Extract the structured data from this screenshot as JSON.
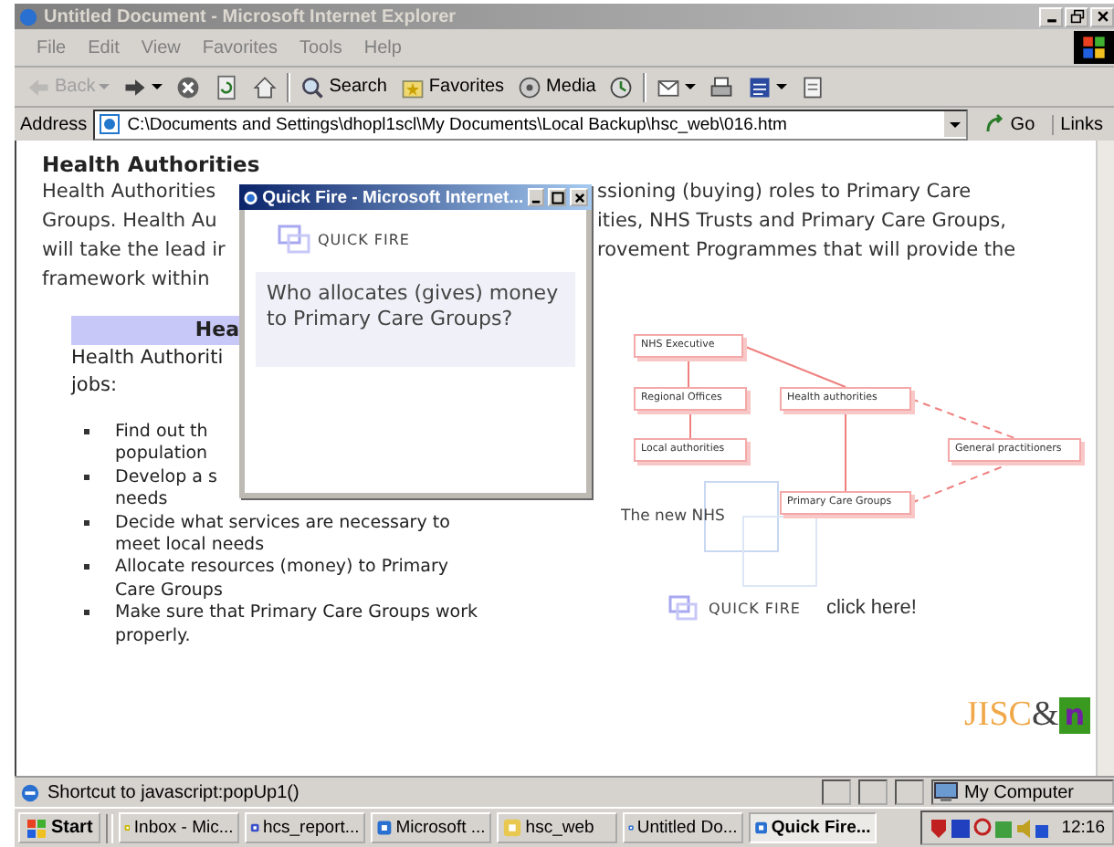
{
  "window": {
    "title": "Untitled Document - Microsoft Internet Explorer"
  },
  "menu": [
    "File",
    "Edit",
    "View",
    "Favorites",
    "Tools",
    "Help"
  ],
  "toolbar": [
    {
      "kind": "back",
      "label": "Back",
      "disabled": true,
      "menu": true
    },
    {
      "kind": "forward",
      "disabled": false,
      "menu": true
    },
    {
      "kind": "stop",
      "disabled": false,
      "menu": false
    },
    {
      "kind": "refresh",
      "disabled": false,
      "menu": false
    },
    {
      "kind": "home",
      "disabled": false,
      "menu": false
    },
    {
      "kind": "search",
      "label": "Search",
      "disabled": false,
      "menu": false
    },
    {
      "kind": "favorites",
      "label": "Favorites",
      "disabled": false,
      "menu": false
    },
    {
      "kind": "media",
      "label": "Media",
      "disabled": false,
      "menu": false
    },
    {
      "kind": "history",
      "disabled": false,
      "menu": false
    },
    {
      "kind": "mail",
      "disabled": false,
      "menu": true
    },
    {
      "kind": "print",
      "disabled": false,
      "menu": false
    },
    {
      "kind": "edit",
      "disabled": false,
      "menu": true
    },
    {
      "kind": "discuss",
      "disabled": false,
      "menu": false
    }
  ],
  "address": {
    "label": "Address",
    "value": "C:\\Documents and Settings\\dhopl1scl\\My Documents\\Local Backup\\hsc_web\\016.htm",
    "go": "Go",
    "links": "Links"
  },
  "page": {
    "heading": "Health Authorities",
    "paragraph_rows": [
      {
        "left": "Health Authorities",
        "right": "ssioning (buying) roles to Primary Care"
      },
      {
        "left": "Groups. Health Au",
        "right": "ities, NHS Trusts and Primary Care Groups,"
      },
      {
        "left": "will take the lead ir",
        "right": "rovement Programmes that will provide the"
      },
      {
        "left": "framework within"
      }
    ],
    "section_heading": "Hea",
    "intro_lines": [
      "Health Authoriti",
      "jobs:"
    ],
    "bullets": [
      {
        "lines": [
          "Find out th",
          "population"
        ]
      },
      {
        "lines": [
          "Develop a s",
          "needs"
        ]
      },
      {
        "lines": [
          "Decide what services are necessary to",
          "meet local needs"
        ]
      },
      {
        "lines": [
          "Allocate resources (money) to Primary",
          "Care Groups"
        ]
      },
      {
        "lines": [
          "Make sure that Primary Care Groups work",
          "properly."
        ]
      }
    ],
    "diagram": {
      "nodes": [
        "NHS Executive",
        "Regional Offices",
        "Local authorities",
        "Health authorities",
        "General practitioners",
        "Primary Care Groups"
      ],
      "caption": "The new NHS"
    },
    "quick_fire": {
      "label": "QUICK FIRE",
      "link": "click here!"
    },
    "logo": [
      "JISC",
      "&",
      "n"
    ]
  },
  "popup": {
    "title": "Quick Fire - Microsoft Internet...",
    "label": "QUICK FIRE",
    "question": "Who allocates (gives) money to Primary Care Groups?"
  },
  "status_bar": {
    "text": "Shortcut to javascript:popUp1()",
    "zone": "My Computer"
  },
  "taskbar": {
    "start": "Start",
    "tasks": [
      {
        "label": "Inbox - Mic...",
        "kind": "mail",
        "selected": false
      },
      {
        "label": "hcs_report...",
        "kind": "doc",
        "selected": false
      },
      {
        "label": "Microsoft ...",
        "kind": "ie",
        "selected": false
      },
      {
        "label": "hsc_web",
        "kind": "folder",
        "selected": false
      },
      {
        "label": "Untitled Do...",
        "kind": "ie",
        "selected": false
      },
      {
        "label": "Quick Fire...",
        "kind": "ie",
        "selected": true
      }
    ],
    "clock": "12:16"
  }
}
